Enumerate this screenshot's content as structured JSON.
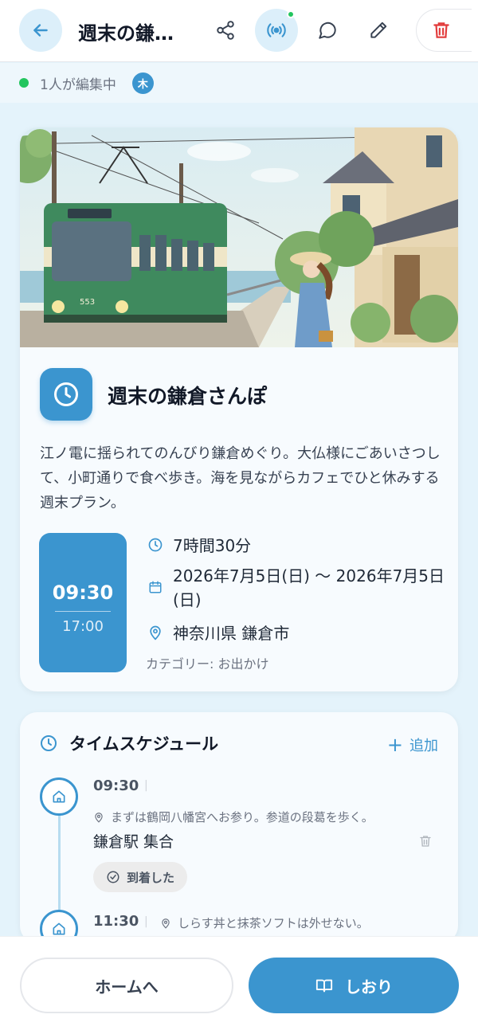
{
  "header": {
    "title": "週末の鎌…",
    "icons": {
      "back": "arrow-left-icon",
      "share": "share-icon",
      "live": "broadcast-icon",
      "comment": "comment-icon",
      "edit": "pencil-icon",
      "delete": "trash-icon"
    },
    "accent_color": "#3b95cf",
    "delete_color": "#e23b3b"
  },
  "presence": {
    "text": "1人が編集中",
    "avatar_initial": "木",
    "status_color": "#22c55e"
  },
  "plan": {
    "title": "週末の鎌倉さんぽ",
    "description": "江ノ電に揺られてのんびり鎌倉めぐり。大仏様にごあいさつして、小町通りで食べ歩き。海を見ながらカフェでひと休みする週末プラン。",
    "start_time": "09:30",
    "end_time": "17:00",
    "duration": "7時間30分",
    "dates": "2026年7月5日(日) 〜 2026年7月5日(日)",
    "location": "神奈川県 鎌倉市",
    "category": "カテゴリー: お出かけ",
    "hero_tram_number": "553"
  },
  "schedule": {
    "title": "タイムスケジュール",
    "add_label": "追加",
    "items": [
      {
        "time": "09:30",
        "note": "まずは鶴岡八幡宮へお参り。参道の段葛を歩く。",
        "name": "鎌倉駅 集合",
        "status": "到着した"
      },
      {
        "time": "11:30",
        "note": "しらす丼と抹茶ソフトは外せない。"
      }
    ]
  },
  "footer": {
    "home_label": "ホームへ",
    "guide_label": "しおり"
  }
}
